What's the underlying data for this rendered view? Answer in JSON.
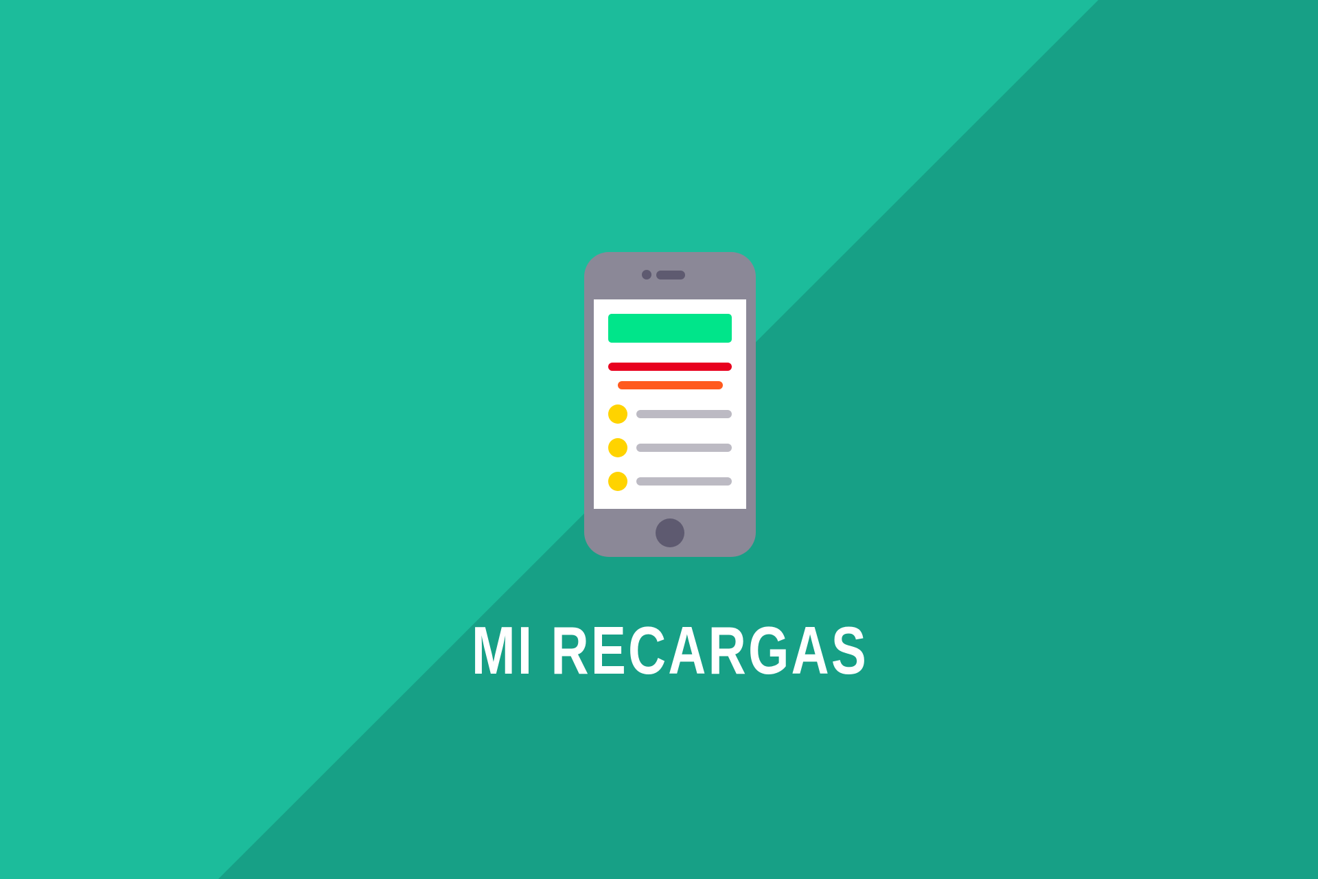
{
  "title": "MI RECARGAS",
  "colors": {
    "background_light": "#1cbc9b",
    "background_dark": "#17a086",
    "phone_body": "#8b8897",
    "phone_details": "#5e5a70",
    "screen": "#ffffff",
    "header_bar": "#00e58a",
    "line_red": "#e8001e",
    "line_orange": "#ff5a1e",
    "bullet": "#ffd300",
    "item_line": "#bcbac3",
    "title_text": "#ffffff"
  },
  "icons": {
    "phone": "smartphone-icon",
    "list_bullet": "dot-icon"
  }
}
